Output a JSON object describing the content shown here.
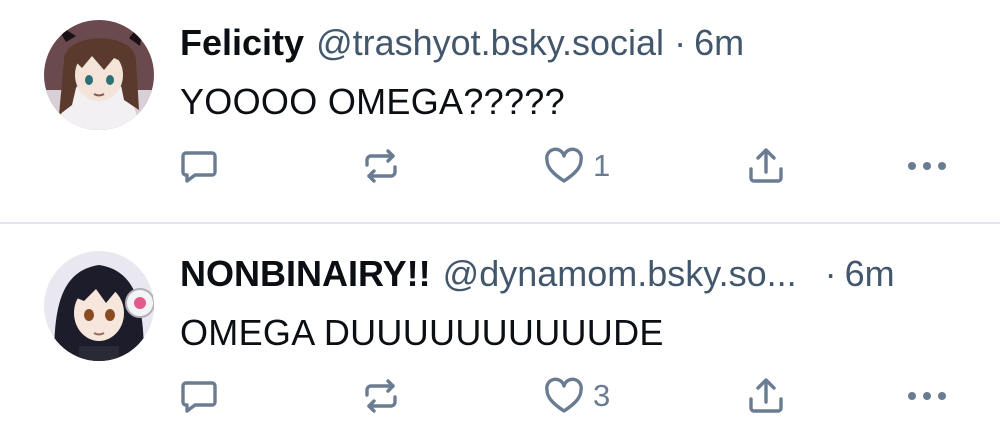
{
  "posts": [
    {
      "author": {
        "display_name": "Felicity",
        "handle": "@trashyot.bsky.social"
      },
      "separator": "·",
      "timestamp": "6m",
      "text": "YOOOO OMEGA?????",
      "like_count": "1",
      "avatar": {
        "bg": "#6b4a4f",
        "hair": "#5a3a2c",
        "skin": "#f3e3d8",
        "eye": "#2b6f78"
      }
    },
    {
      "author": {
        "display_name": "NONBINAIRY!!",
        "handle": "@dynamom.bsky.so..."
      },
      "separator": "·",
      "timestamp": "6m",
      "text": "OMEGA DUUUUUUUUUUDE",
      "like_count": "3",
      "avatar": {
        "bg": "#e9e7ef",
        "hair": "#1c1c2a",
        "skin": "#f7e6dc",
        "eye": "#8a4a22"
      }
    }
  ],
  "icons": {
    "reply": "reply-icon",
    "repost": "repost-icon",
    "like": "heart-icon",
    "share": "share-icon",
    "more": "more-icon"
  },
  "colors": {
    "text_primary": "#0b0f14",
    "text_secondary": "#42576c",
    "icon": "#6a7c91",
    "divider": "#e3e6ea"
  }
}
